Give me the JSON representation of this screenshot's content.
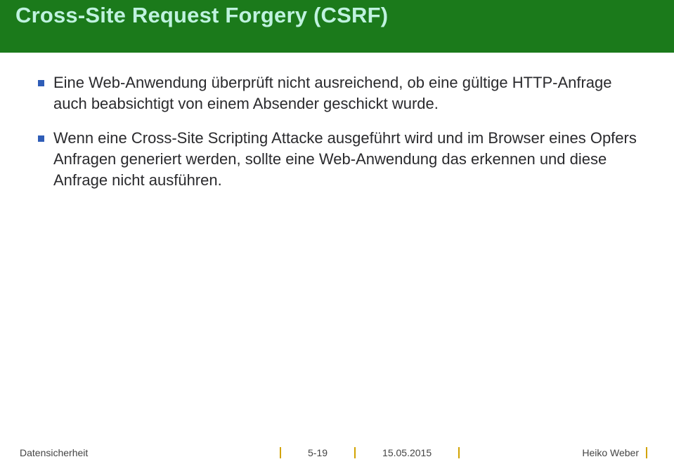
{
  "header": {
    "title": "Cross-Site Request Forgery (CSRF)"
  },
  "content": {
    "bullets": [
      "Eine Web-Anwendung überprüft nicht ausreichend, ob eine gültige HTTP-Anfrage auch beabsichtigt von einem Absender geschickt wurde.",
      "Wenn eine Cross-Site Scripting Attacke ausgeführt wird und im Browser eines Opfers Anfragen generiert werden, sollte eine Web-Anwendung das erkennen und diese Anfrage nicht ausführen."
    ]
  },
  "footer": {
    "left": "Datensicherheit",
    "page": "5-19",
    "date": "15.05.2015",
    "author": "Heiko Weber"
  }
}
